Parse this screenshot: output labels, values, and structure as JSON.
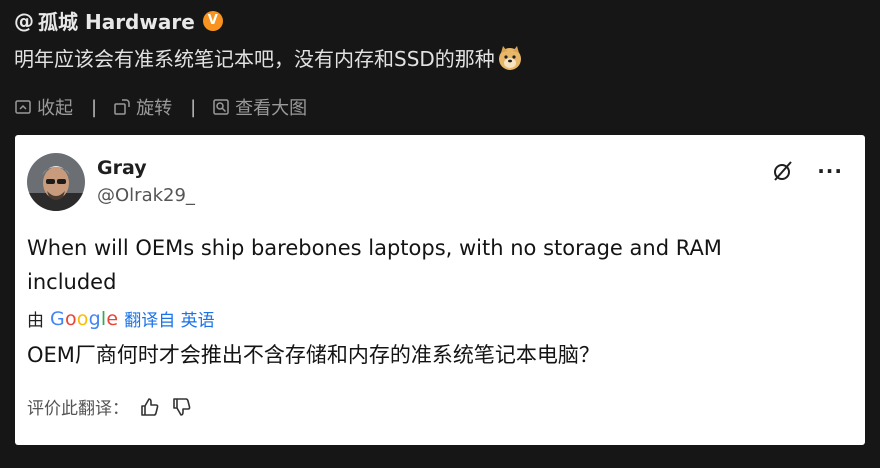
{
  "header": {
    "at_symbol": "@",
    "author": "孤城 Hardware",
    "verified_mark": "V"
  },
  "post": {
    "text": "明年应该会有准系统笔记本吧，没有内存和SSD的那种",
    "emoji": "doge-emoji"
  },
  "actions": {
    "collapse_label": "收起",
    "rotate_label": "旋转",
    "view_large_label": "查看大图",
    "separator": "|"
  },
  "card": {
    "user_name": "Gray",
    "user_handle": "@Olrak29_",
    "more_label": "···",
    "tweet_text": "When will OEMs ship barebones laptops, with no storage and RAM included",
    "translated_by": "由",
    "google_letters": [
      "G",
      "o",
      "o",
      "g",
      "l",
      "e"
    ],
    "translated_from": "翻译自 英语",
    "translated_text": "OEM厂商何时才会推出不含存储和内存的准系统笔记本电脑？",
    "rate_label": "评价此翻译："
  },
  "colors": {
    "background": "#161616",
    "verified": "#f7931e",
    "link_blue": "#1a73e8"
  }
}
